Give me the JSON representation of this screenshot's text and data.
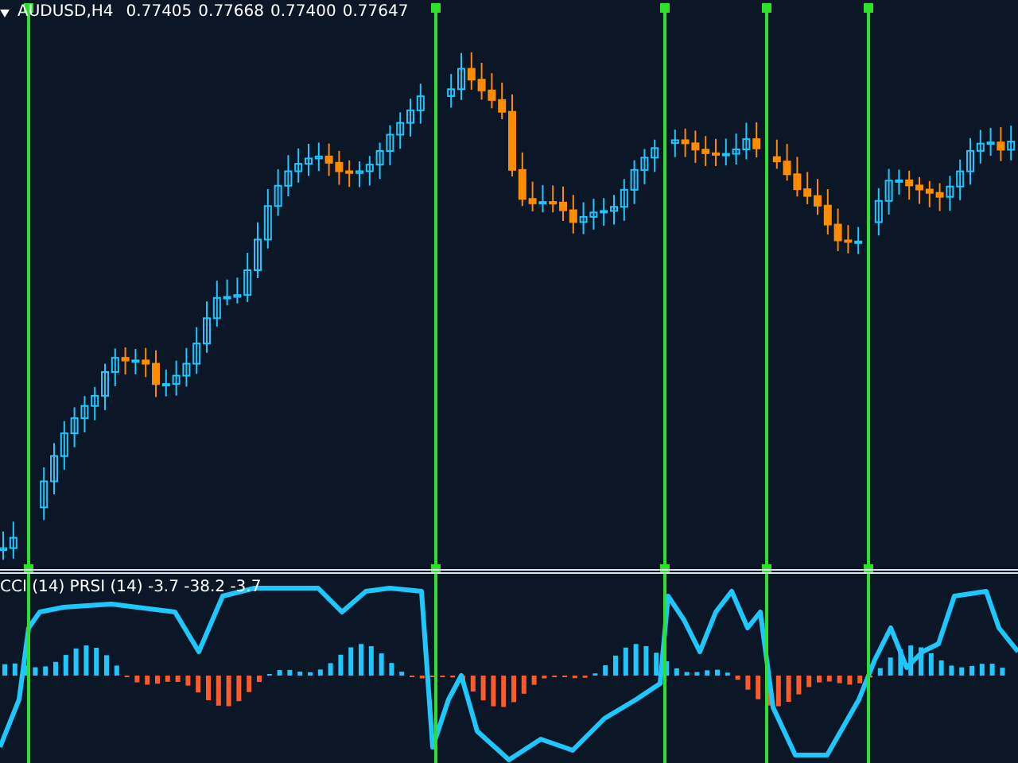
{
  "main_chart": {
    "symbol": "AUDUSD,H4",
    "quotes": [
      "0.77405",
      "0.77668",
      "0.77400",
      "0.77647"
    ]
  },
  "indicator_pane": {
    "label": "CCI (14) PRSI (14) -3.7 -38.2 -3.7"
  }
}
